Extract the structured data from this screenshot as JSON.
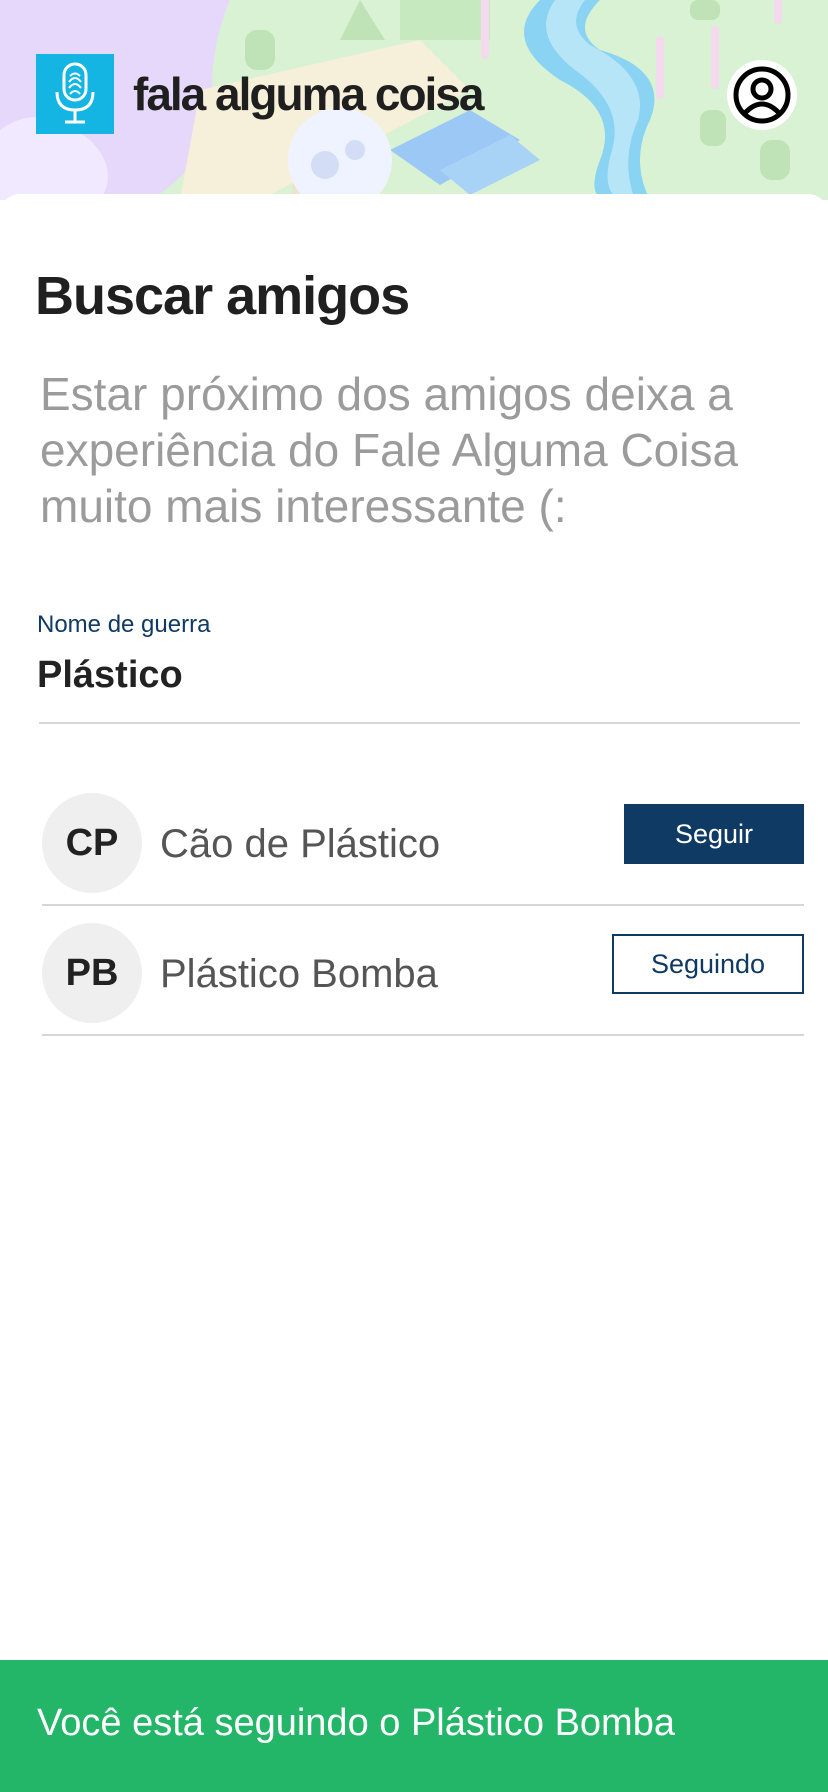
{
  "header": {
    "brand": "fala alguma coisa",
    "logo_icon": "microphone-fingerprint-icon",
    "profile_icon": "user-circle-icon",
    "colors": {
      "logo": "#14b5e3",
      "map_green": "#d9f2d3",
      "river": "#8ad3f2"
    }
  },
  "page": {
    "title": "Buscar amigos",
    "subtitle": "Estar próximo dos amigos deixa a experiência do Fale Alguma Coisa muito mais interessante (:"
  },
  "search": {
    "label": "Nome de guerra",
    "value": "Plástico"
  },
  "results": [
    {
      "initials": "CP",
      "name": "Cão de Plástico",
      "action": "Seguir"
    },
    {
      "initials": "PB",
      "name": "Plástico Bomba",
      "action": "Seguindo"
    }
  ],
  "snackbar": {
    "message": "Você está seguindo o Plástico Bomba",
    "color": "#24b668"
  },
  "accent": "#0f3a64"
}
